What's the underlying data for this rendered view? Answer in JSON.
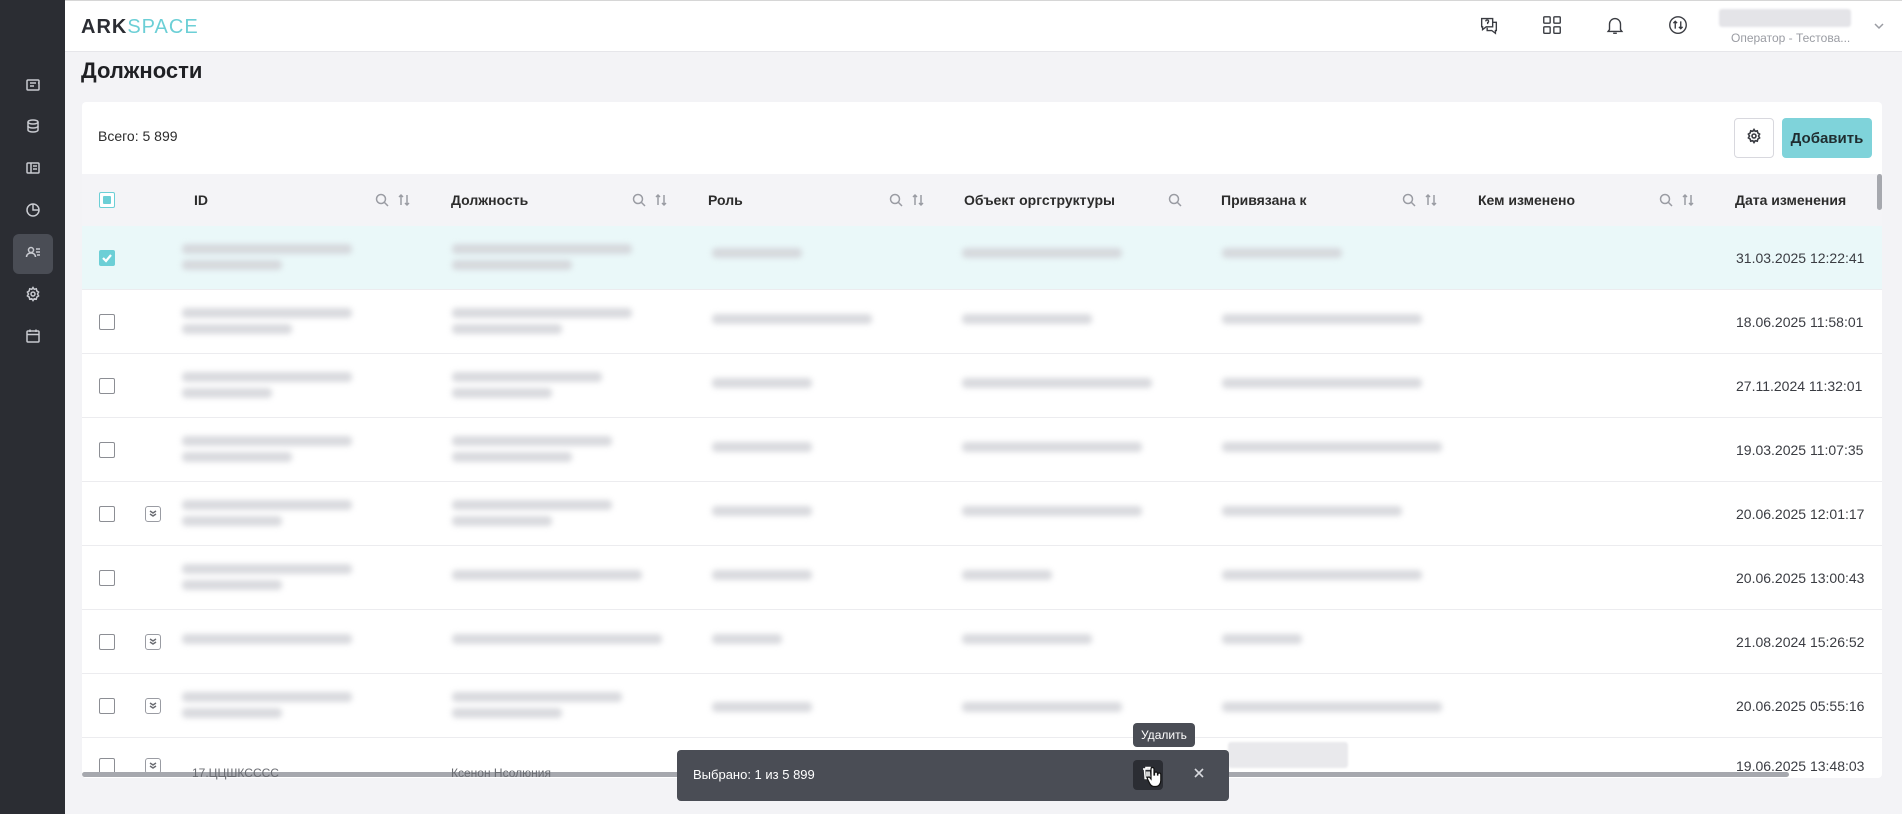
{
  "app": {
    "logo_primary": "ARK",
    "logo_secondary": "SPACE"
  },
  "header": {
    "user_role": "Оператор - Тестова...",
    "icons": [
      "help-chat-icon",
      "apps-grid-icon",
      "bell-icon",
      "sync-icon"
    ]
  },
  "sidebar": {
    "icons": [
      "list-icon",
      "database-icon",
      "book-icon",
      "pie-chart-icon",
      "users-icon",
      "gear-icon",
      "calendar-icon"
    ],
    "active_index": 4
  },
  "page": {
    "title": "Должности"
  },
  "toolbar": {
    "total_label": "Всего: 5 899",
    "add_label": "Добавить"
  },
  "table": {
    "columns": [
      {
        "label": "ID",
        "search": true,
        "sort": true
      },
      {
        "label": "Должность",
        "search": true,
        "sort": true
      },
      {
        "label": "Роль",
        "search": true,
        "sort": true
      },
      {
        "label": "Объект оргструктуры",
        "search": true,
        "sort": false
      },
      {
        "label": "Привязана к",
        "search": true,
        "sort": true
      },
      {
        "label": "Кем изменено",
        "search": true,
        "sort": true
      },
      {
        "label": "Дата изменения",
        "search": false,
        "sort": false
      }
    ],
    "rows": [
      {
        "checked": true,
        "expandable": false,
        "date": "31.03.2025 12:22:41"
      },
      {
        "checked": false,
        "expandable": false,
        "date": "18.06.2025 11:58:01"
      },
      {
        "checked": false,
        "expandable": false,
        "date": "27.11.2024 11:32:01"
      },
      {
        "checked": false,
        "expandable": false,
        "date": "19.03.2025 11:07:35"
      },
      {
        "checked": false,
        "expandable": true,
        "date": "20.06.2025 12:01:17"
      },
      {
        "checked": false,
        "expandable": false,
        "date": "20.06.2025 13:00:43"
      },
      {
        "checked": false,
        "expandable": true,
        "date": "21.08.2024 15:26:52"
      },
      {
        "checked": false,
        "expandable": true,
        "date": "20.06.2025 05:55:16"
      },
      {
        "checked": false,
        "expandable": true,
        "date": "19.06.2025 13:48:03"
      }
    ],
    "last_row_peek": [
      "17.ЦЦШКСССС",
      "Ксенон Нсолюния"
    ]
  },
  "selection": {
    "text": "Выбрано: 1 из 5 899",
    "delete_tooltip": "Удалить"
  },
  "colors": {
    "accent": "#6ccfd6",
    "sidebar": "#2b2d33",
    "selbar": "#4a4d55"
  }
}
